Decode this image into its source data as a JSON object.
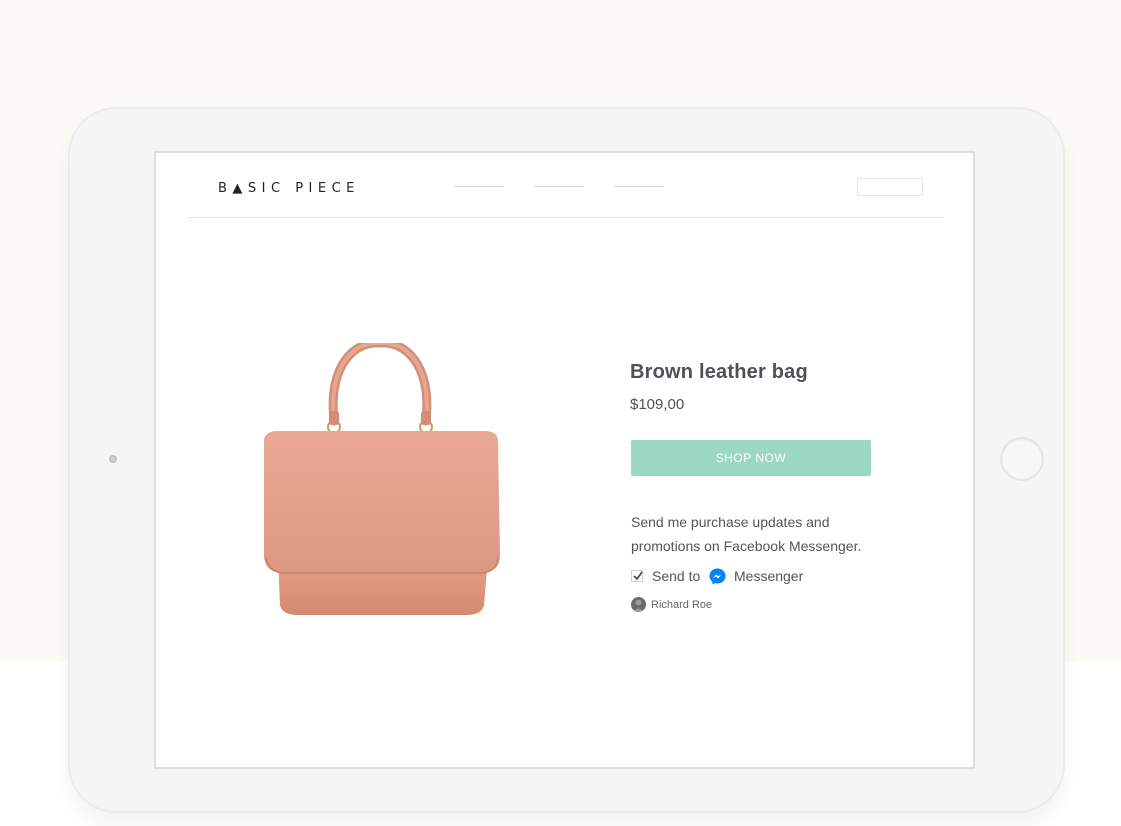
{
  "brand": {
    "logo_text": "B▲SIC PIECE"
  },
  "product": {
    "title": "Brown leather bag",
    "price": "$109,00",
    "shop_button_label": "SHOP NOW",
    "image_icon": "handbag-image"
  },
  "messenger_optin": {
    "description": "Send me purchase updates and promotions on Facebook Messenger.",
    "checked": true,
    "send_to_label": "Send to",
    "service_label": "Messenger",
    "user_name": "Richard Roe"
  },
  "colors": {
    "background": "#fbfaf6",
    "device_frame": "#f5f5f5",
    "accent": "#9bd7c2",
    "text": "#4d5257",
    "messenger_blue": "#0084ff",
    "bag": "#e6a28c"
  }
}
